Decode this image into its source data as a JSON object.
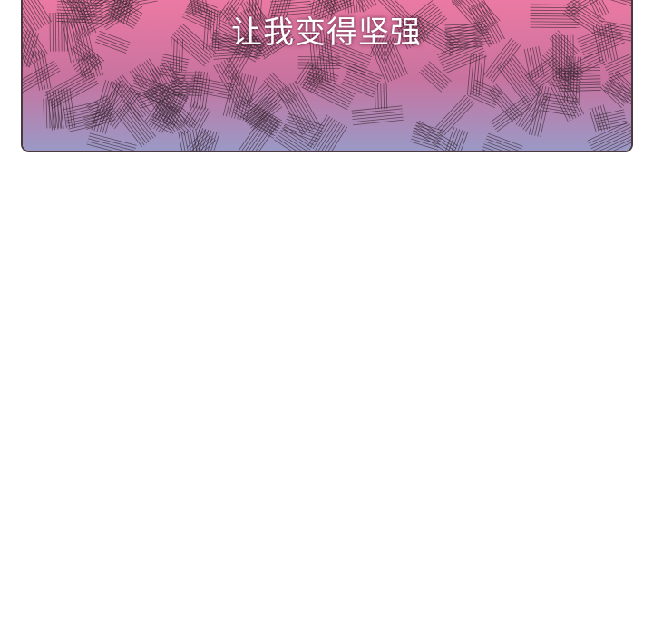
{
  "caption": "让我变得坚强",
  "colors": {
    "panel_top": "#ef7aa3",
    "panel_middle": "#c873a0",
    "panel_bottom": "#9a99c6",
    "hatch": "#3c2a34",
    "border": "#4a3a40",
    "caption_text": "#ffffff"
  }
}
